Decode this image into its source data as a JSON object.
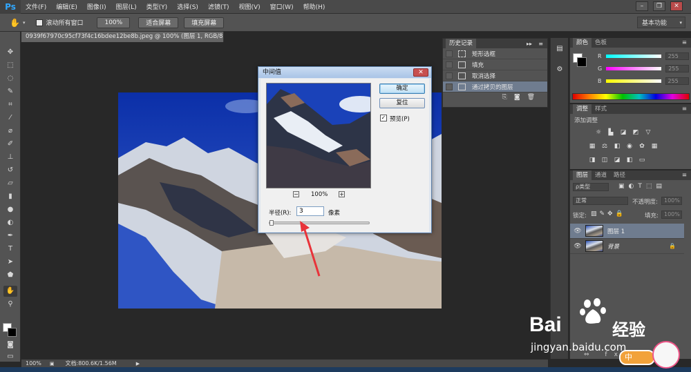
{
  "app": {
    "logo": "Ps"
  },
  "menu": [
    "文件(F)",
    "编辑(E)",
    "图像(I)",
    "图层(L)",
    "类型(Y)",
    "选择(S)",
    "滤镜(T)",
    "视图(V)",
    "窗口(W)",
    "帮助(H)"
  ],
  "options": {
    "scroll_all_label": "滚动所有窗口",
    "zoom_100": "100%",
    "fit_screen": "适合屏幕",
    "fill_screen": "填充屏幕",
    "workspace": "基本功能"
  },
  "document": {
    "tab_title": "0939f67970c95cf73f4c16bdee12be8b.jpeg @ 100% (图层 1, RGB/8#) *",
    "tab_close": "×",
    "status_zoom": "100%",
    "status_doc": "文档:800.6K/1.56M"
  },
  "history": {
    "tab_label": "历史记录",
    "items": [
      {
        "label": "矩形选框",
        "selected": false
      },
      {
        "label": "填充",
        "selected": false
      },
      {
        "label": "取消选择",
        "selected": false
      },
      {
        "label": "通过拷贝的图层",
        "selected": true
      }
    ]
  },
  "color_panel": {
    "tabs": [
      "颜色",
      "色板"
    ],
    "channels": [
      {
        "name": "R",
        "value": "255",
        "bar_color": "#00ffff"
      },
      {
        "name": "G",
        "value": "255",
        "bar_color": "#ff00ff"
      },
      {
        "name": "B",
        "value": "255",
        "bar_color": "#ffff00"
      }
    ]
  },
  "adjustments_panel": {
    "tabs": [
      "调整",
      "样式"
    ],
    "title": "添加调整"
  },
  "layers_panel": {
    "tabs": [
      "图层",
      "通道",
      "路径"
    ],
    "kind_filter": "ρ类型",
    "blend_mode": "正常",
    "opacity_label": "不透明度:",
    "opacity_value": "100%",
    "lock_label": "锁定:",
    "fill_label": "填充:",
    "fill_value": "100%",
    "layers": [
      {
        "name": "图层 1",
        "selected": true,
        "locked": false
      },
      {
        "name": "背景",
        "selected": false,
        "locked": true
      }
    ]
  },
  "dialog": {
    "title": "中间值",
    "close": "✕",
    "ok": "确定",
    "reset": "复位",
    "preview_label": "预览(P)",
    "preview_checked": true,
    "zoom_out": "−",
    "zoom_in": "+",
    "zoom_level": "100%",
    "radius_label": "半径(R):",
    "radius_value": "3",
    "unit": "像素"
  },
  "watermark": {
    "brand": "Bai",
    "brand2": "经验",
    "url": "jingyan.baidu.com",
    "badge": "中"
  },
  "colors": {
    "accent": "#31a8ff",
    "selection": "#6f7c8f",
    "arrow": "#e8333a"
  }
}
